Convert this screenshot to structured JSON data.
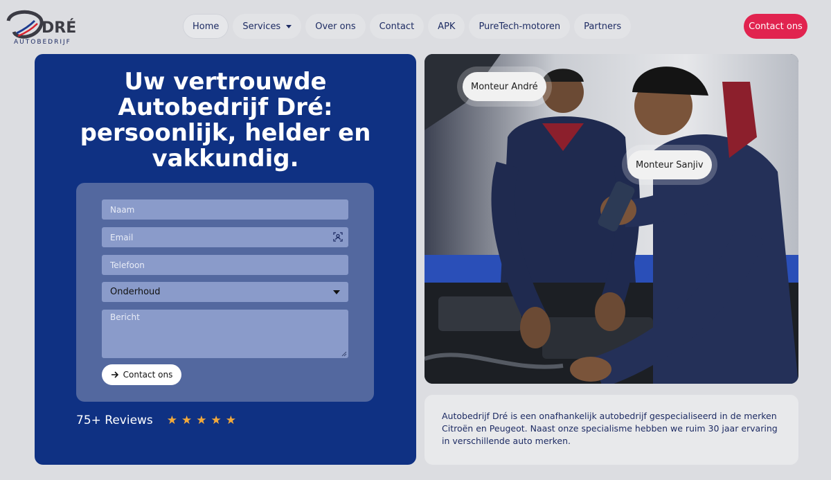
{
  "logo": {
    "word": "DRÉ",
    "sub": "AUTOBEDRIJF"
  },
  "nav": {
    "items": [
      {
        "label": "Home"
      },
      {
        "label": "Services"
      },
      {
        "label": "Over ons"
      },
      {
        "label": "Contact"
      },
      {
        "label": "APK"
      },
      {
        "label": "PureTech-motoren"
      },
      {
        "label": "Partners"
      }
    ],
    "cta": "Contact ons"
  },
  "hero": {
    "title_lines": [
      "Uw vertrouwde",
      "Autobedrijf Dré:",
      "persoonlijk, helder en",
      "vakkundig."
    ],
    "form": {
      "name_placeholder": "Naam",
      "email_placeholder": "Email",
      "phone_placeholder": "Telefoon",
      "service_selected": "Onderhoud",
      "message_placeholder": "Bericht",
      "submit_label": "Contact ons"
    },
    "reviews": {
      "text": "75+ Reviews",
      "rating": 5,
      "max": 5
    }
  },
  "photo": {
    "tags": [
      "Monteur André",
      "Monteur Sanjiv"
    ]
  },
  "about": {
    "text": "Autobedrijf Dré is een onafhankelijk autobedrijf gespecialiseerd in de merken Citroën en Peugeot. Naast onze specialisme hebben we ruim 30 jaar ervaring in verschillende auto merken."
  },
  "colors": {
    "brand_blue": "#0f3183",
    "accent_red": "#e1234f",
    "star": "#f2a93b"
  }
}
